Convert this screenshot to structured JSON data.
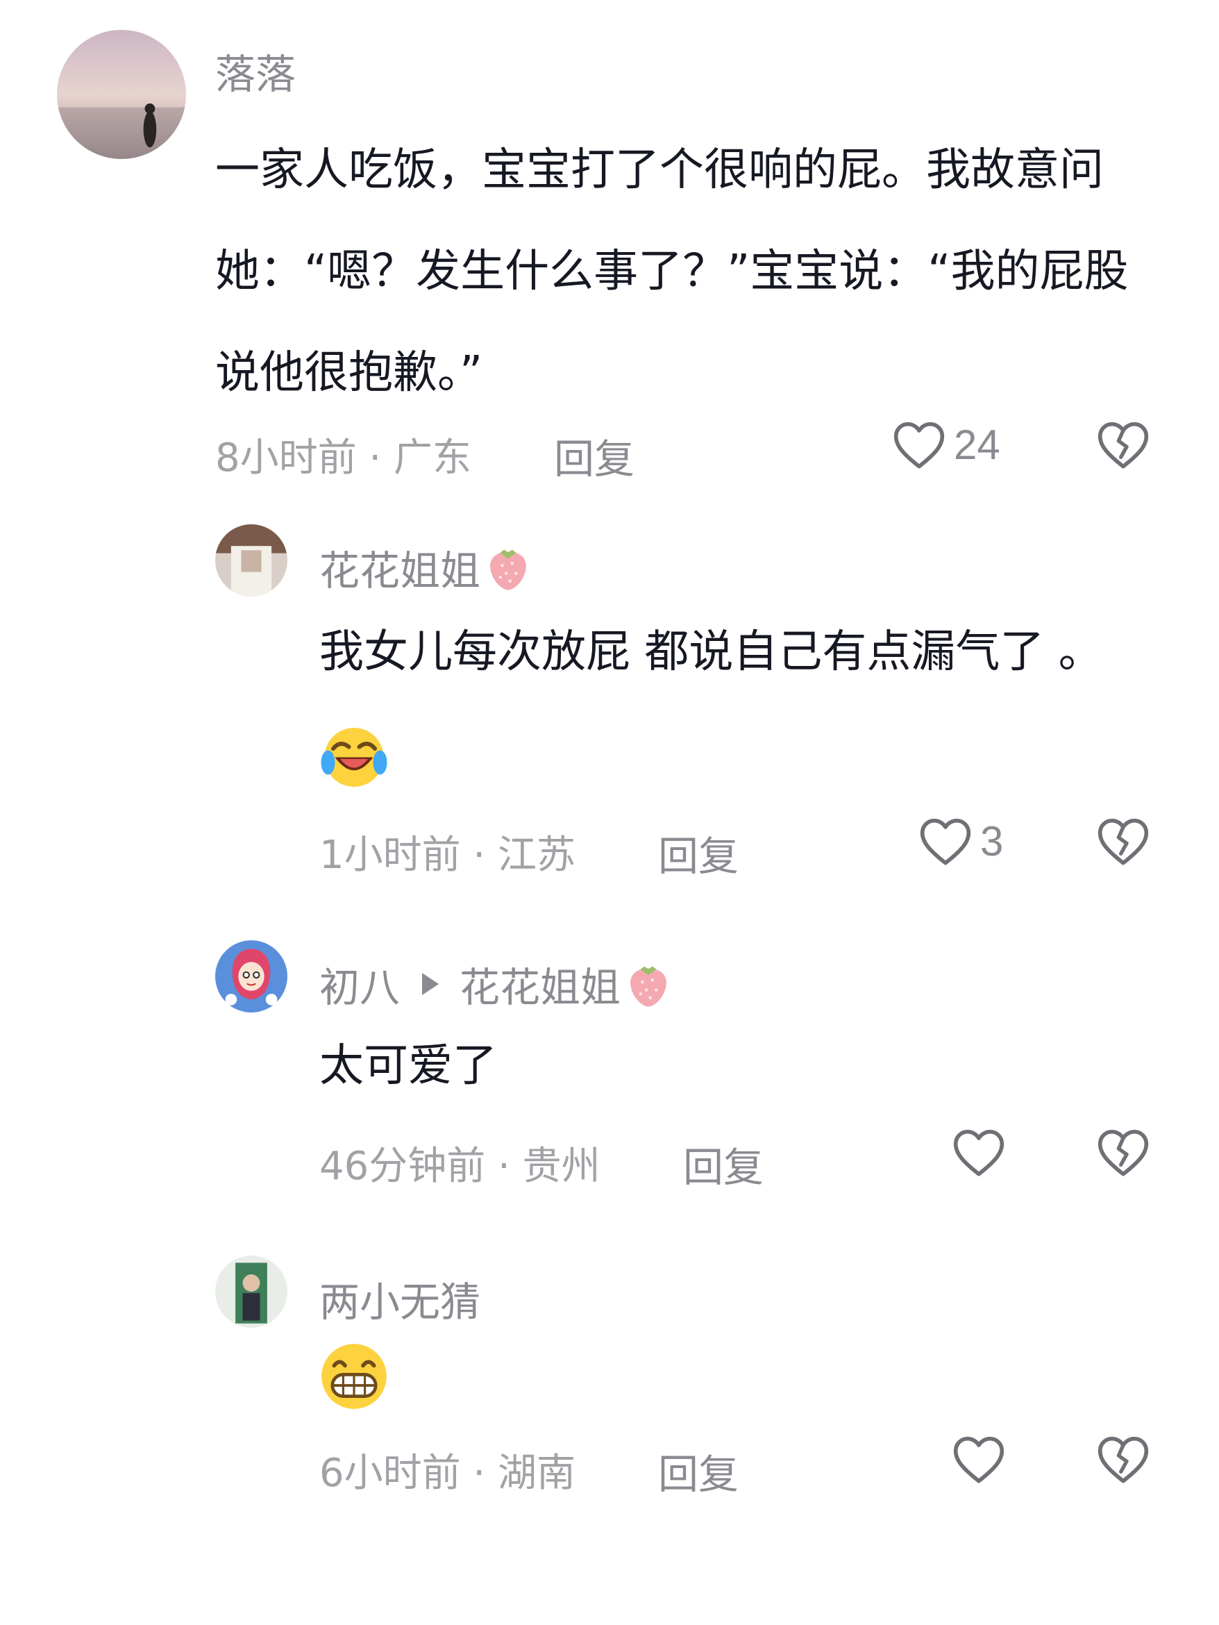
{
  "comments": [
    {
      "username": "落落",
      "text": "一家人吃饭，宝宝打了个很响的屁。我故意问她：“嗯？发生什么事了？”宝宝说：“我的屁股说他很抱歉。”",
      "time": "8小时前 · 广东",
      "reply_label": "回复",
      "likes": "24",
      "avatar_icon": "sunset-beach-avatar"
    },
    {
      "username": "花花姐姐",
      "badge_icon": "strawberry-icon",
      "text": "我女儿每次放屁 都说自己有点漏气了 。",
      "emoji_icon": "laughing-tears-emoji",
      "time": "1小时前 · 江苏",
      "reply_label": "回复",
      "likes": "3"
    },
    {
      "username": "初八",
      "reply_to": "花花姐姐",
      "badge_icon": "strawberry-icon",
      "text": "太可爱了",
      "time": "46分钟前 · 贵州",
      "reply_label": "回复",
      "likes": ""
    },
    {
      "username": "两小无猜",
      "emoji_icon": "grinning-emoji",
      "time": "6小时前 · 湖南",
      "reply_label": "回复",
      "likes": ""
    }
  ],
  "colors": {
    "text": "#161823",
    "secondary": "#8a8b91",
    "meta": "#a1a2a6",
    "icon_stroke": "#6f7075"
  }
}
